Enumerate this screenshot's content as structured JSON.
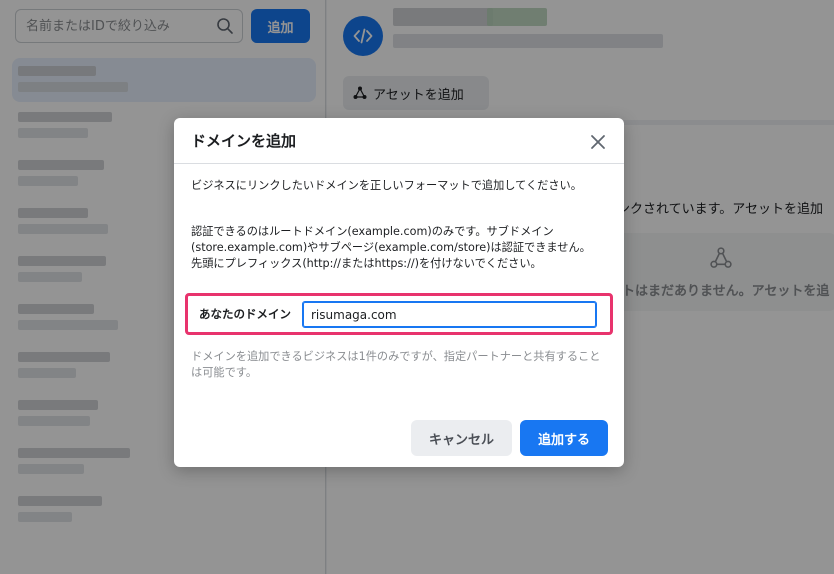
{
  "sidebar": {
    "search_placeholder": "名前またはIDで絞り込み",
    "add_button": "追加"
  },
  "main": {
    "add_asset_button": "アセットを追加",
    "linked_text": "ンクされています。アセットを追加",
    "empty_text": "トはまだありません。アセットを追"
  },
  "modal": {
    "title": "ドメインを追加",
    "paragraph1": "ビジネスにリンクしたいドメインを正しいフォーマットで追加してください。",
    "paragraph2_line1": "認証できるのはルートドメイン(example.com)のみです。サブドメイン",
    "paragraph2_line2": "(store.example.com)やサブページ(example.com/store)は認証できません。",
    "paragraph2_line3": "先頭にプレフィックス(http://またはhttps://)を付けないでください。",
    "domain_label": "あなたのドメイン",
    "domain_value": "risumaga.com",
    "note": "ドメインを追加できるビジネスは1件のみですが、指定パートナーと共有することは可能です。",
    "cancel_button": "キャンセル",
    "submit_button": "追加する"
  },
  "colors": {
    "primary": "#1877f2",
    "highlight": "#e8336d",
    "overlay": "rgba(0,0,0,0.42)"
  }
}
